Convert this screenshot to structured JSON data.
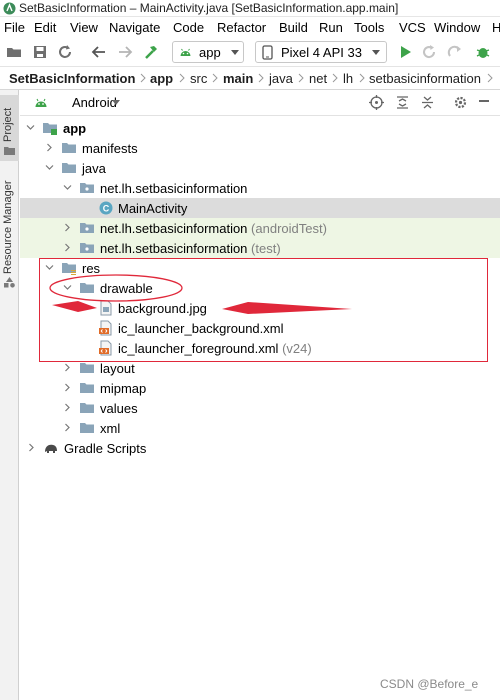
{
  "window": {
    "title": "SetBasicInformation – MainActivity.java [SetBasicInformation.app.main]"
  },
  "menu": [
    "File",
    "Edit",
    "View",
    "Navigate",
    "Code",
    "Refactor",
    "Build",
    "Run",
    "Tools",
    "VCS",
    "Window",
    "H"
  ],
  "toolbar": {
    "module": "app",
    "device": "Pixel 4 API 33"
  },
  "breadcrumb": [
    "SetBasicInformation",
    "app",
    "src",
    "main",
    "java",
    "net",
    "lh",
    "setbasicinformation"
  ],
  "sidebar": {
    "project_tab": "Project",
    "resource_manager_tab": "Resource Manager"
  },
  "panel": {
    "view_mode": "Android"
  },
  "tree": {
    "app": "app",
    "manifests": "manifests",
    "java": "java",
    "pkg_main": "net.lh.setbasicinformation",
    "main_activity": "MainActivity",
    "pkg_android_test": "net.lh.setbasicinformation",
    "android_test_hint": "(androidTest)",
    "pkg_test": "net.lh.setbasicinformation",
    "test_hint": "(test)",
    "res": "res",
    "drawable": "drawable",
    "background": "background.jpg",
    "ic_bg": "ic_launcher_background.xml",
    "ic_fg": "ic_launcher_foreground.xml",
    "ic_fg_hint": "(v24)",
    "layout": "layout",
    "mipmap": "mipmap",
    "values": "values",
    "xml": "xml",
    "gradle": "Gradle Scripts"
  },
  "watermark": "CSDN @Before_e",
  "colors": {
    "annotation": "#e0283a",
    "folder": "#8aa4b8",
    "run": "#3da34a",
    "selected_row": "#dcdcdc",
    "tinted_row": "#eef6e4"
  }
}
